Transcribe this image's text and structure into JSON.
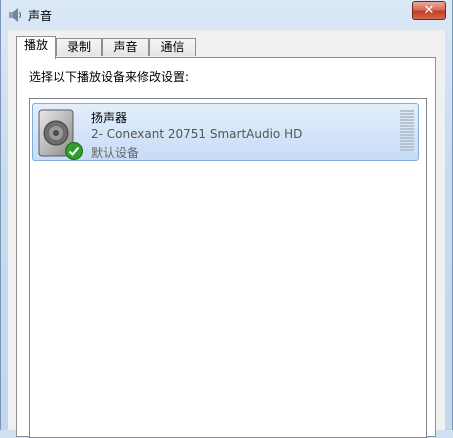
{
  "window": {
    "title": "声音",
    "close_label": "✕"
  },
  "tabs": [
    {
      "label": "播放",
      "active": true
    },
    {
      "label": "录制",
      "active": false
    },
    {
      "label": "声音",
      "active": false
    },
    {
      "label": "通信",
      "active": false
    }
  ],
  "playback": {
    "instruction": "选择以下播放设备来修改设置:",
    "devices": [
      {
        "name": "扬声器",
        "description": "2- Conexant 20751 SmartAudio HD",
        "status": "默认设备",
        "icon": "speaker-icon",
        "badge": "default-check-icon"
      }
    ]
  },
  "colors": {
    "selection": "#cde0f7",
    "selection_border": "#84acdd",
    "close_red": "#c23c21",
    "check_green": "#2f9d2f"
  }
}
